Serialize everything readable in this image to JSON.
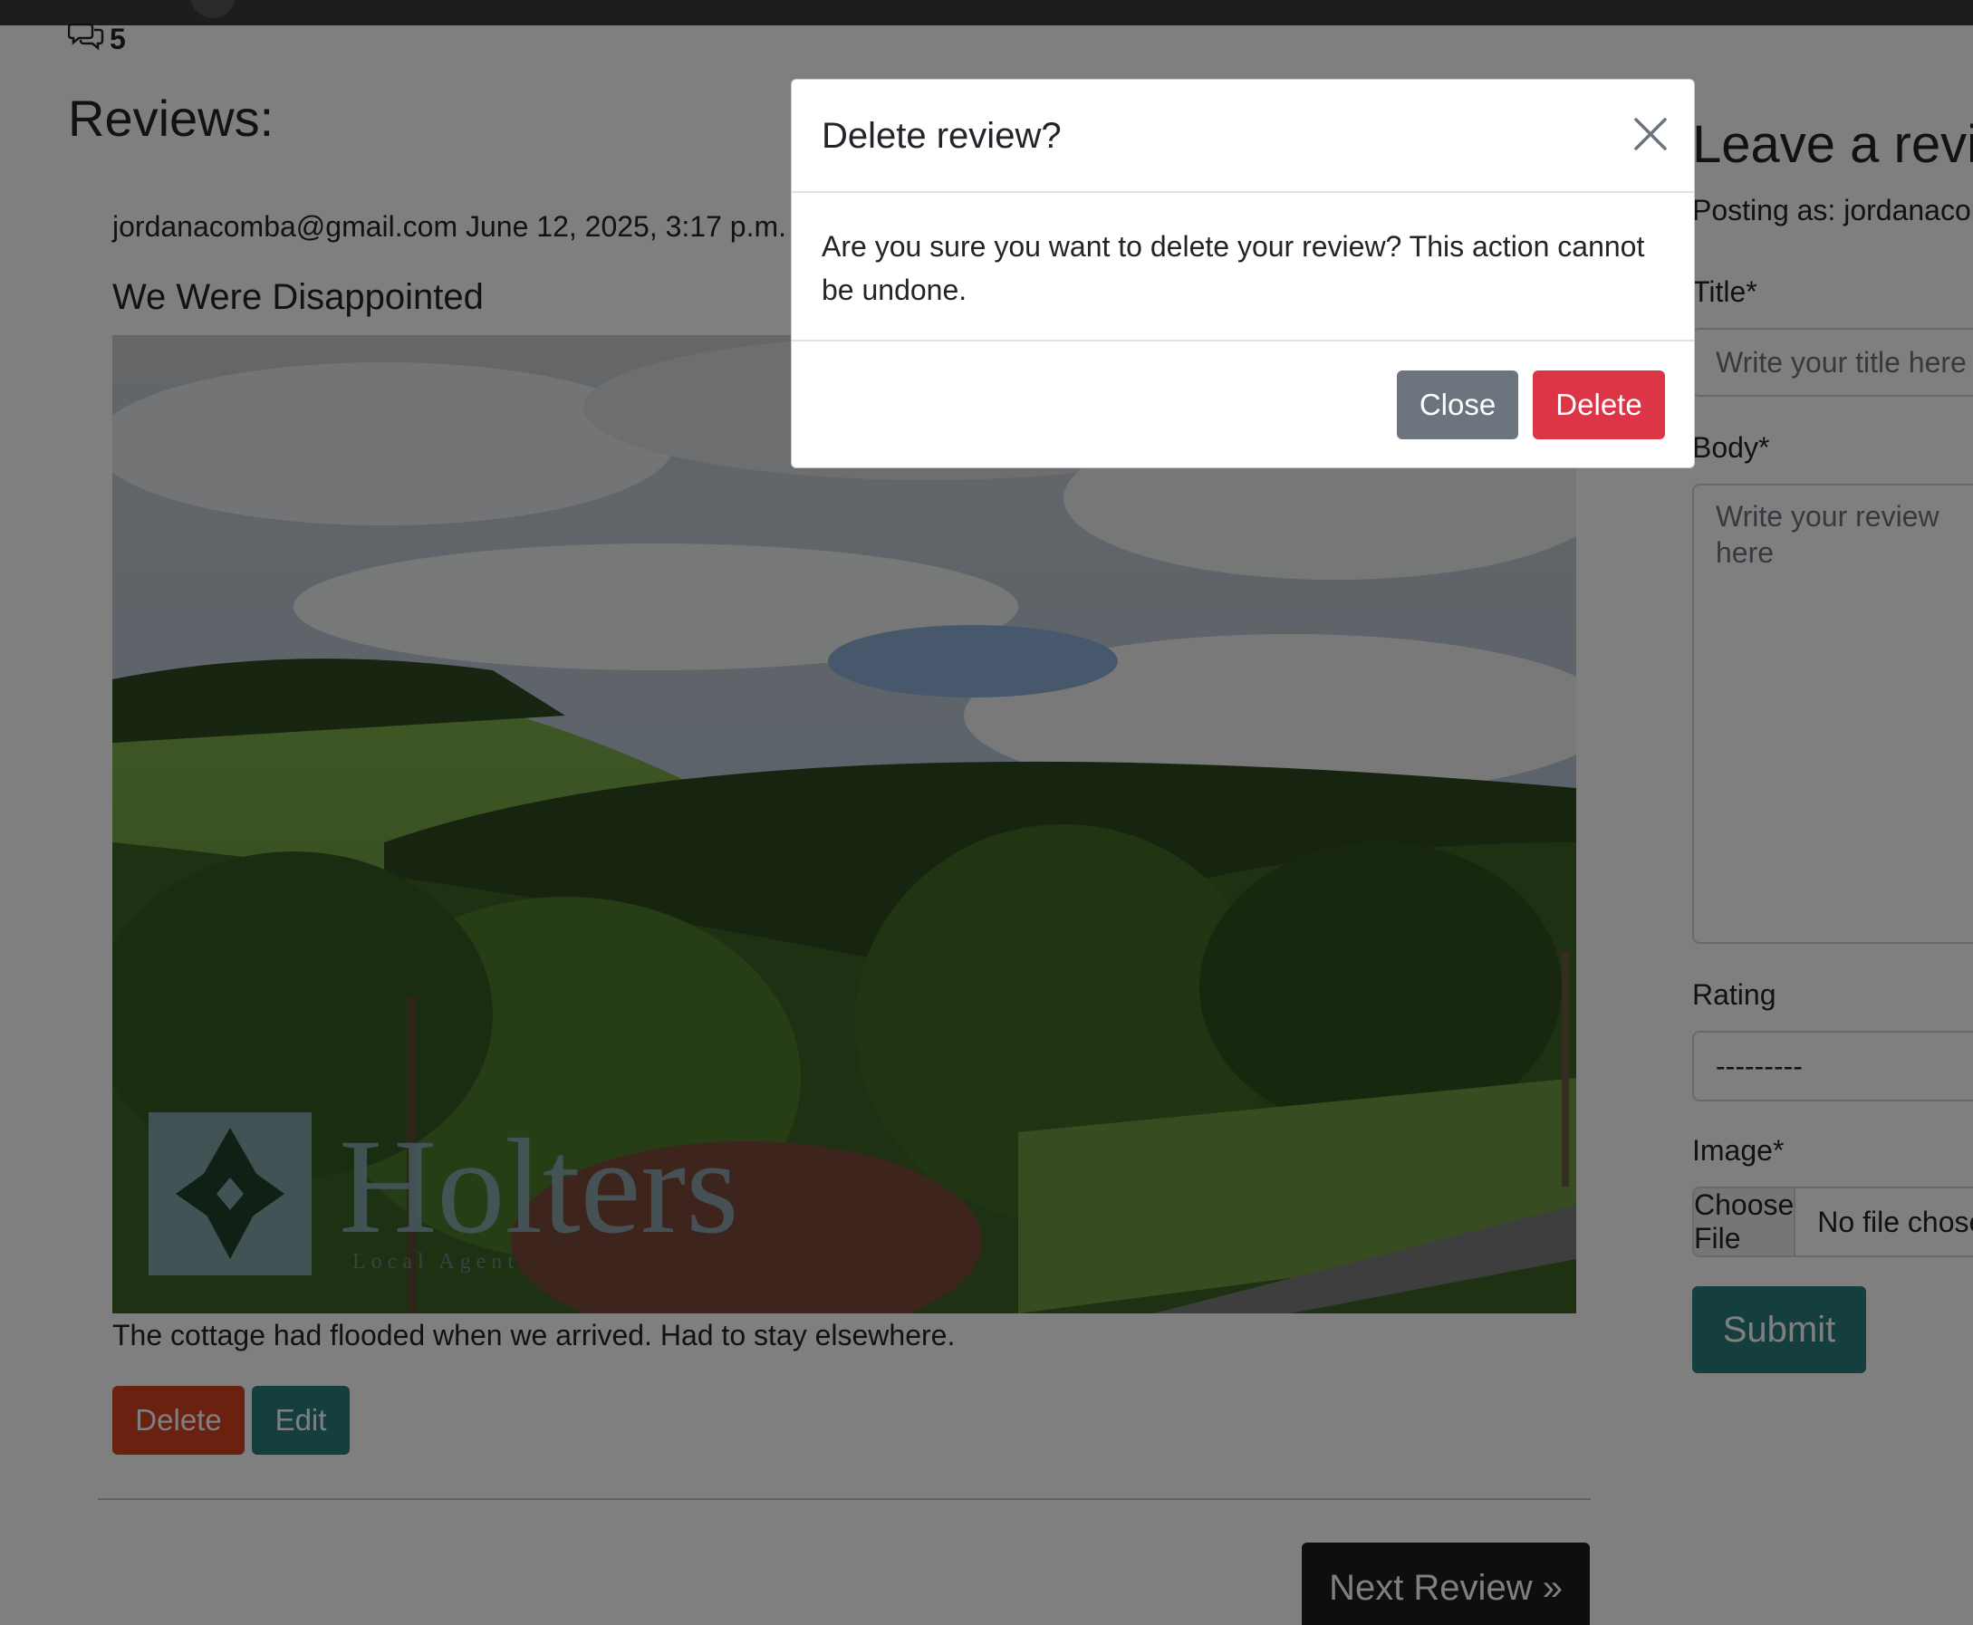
{
  "comments": {
    "count": "5",
    "icon": "comments-icon"
  },
  "reviews": {
    "heading": "Reviews:",
    "item": {
      "author": "jordanacomba@gmail.com",
      "date": "June 12, 2025, 3:17 p.m.",
      "title": "We Were Disappointed",
      "body": "The cottage had flooded when we arrived. Had to stay elsewhere.",
      "image": {
        "logo_text": "Holters",
        "logo_subtext": "Local Agent"
      },
      "delete_label": "Delete",
      "edit_label": "Edit"
    },
    "next_label": "Next Review »"
  },
  "form": {
    "heading": "Leave a review",
    "posting_as": "Posting as: jordanacomba@gmail.com",
    "title_label": "Title*",
    "title_placeholder": "Write your title here",
    "body_label": "Body*",
    "body_placeholder": "Write your review here",
    "rating_label": "Rating",
    "rating_value": "---------",
    "image_label": "Image*",
    "choose_file_label": "Choose File",
    "no_file_label": "No file chosen",
    "submit_label": "Submit"
  },
  "modal": {
    "title": "Delete review?",
    "message": "Are you sure you want to delete your review? This action cannot be undone.",
    "close_label": "Close",
    "delete_label": "Delete",
    "close_icon": "close-icon"
  },
  "colors": {
    "delete_red": "#dc3545",
    "teal": "#2a7f7c",
    "secondary_gray": "#6c757d"
  }
}
